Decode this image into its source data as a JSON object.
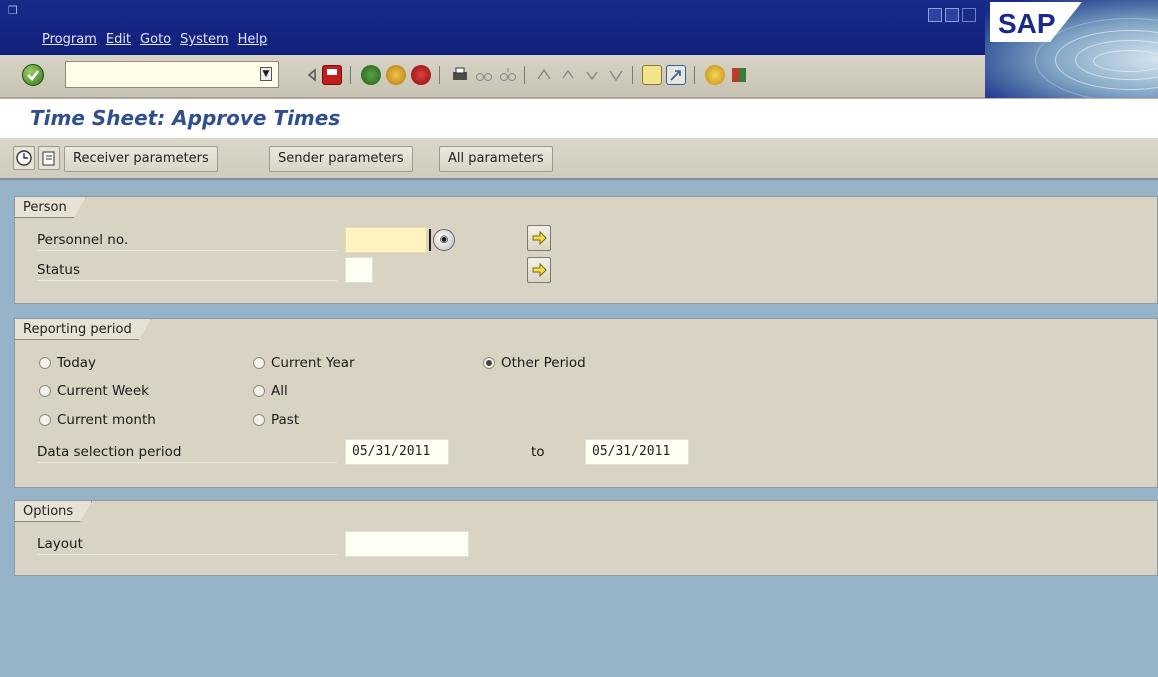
{
  "menu": [
    "Program",
    "Edit",
    "Goto",
    "System",
    "Help"
  ],
  "brand": "SAP",
  "page_title": "Time Sheet: Approve Times",
  "app_toolbar": {
    "buttons": [
      "Receiver parameters",
      "Sender parameters",
      "All parameters"
    ]
  },
  "person": {
    "group_label": "Person",
    "personnel_no_label": "Personnel no.",
    "personnel_no_value": "",
    "status_label": "Status",
    "status_value": ""
  },
  "reporting_period": {
    "group_label": "Reporting period",
    "options": [
      {
        "label": "Today",
        "selected": false
      },
      {
        "label": "Current Week",
        "selected": false
      },
      {
        "label": "Current month",
        "selected": false
      },
      {
        "label": "Current Year",
        "selected": false
      },
      {
        "label": "All",
        "selected": false
      },
      {
        "label": "Past",
        "selected": false
      },
      {
        "label": "Other Period",
        "selected": true
      }
    ],
    "data_selection_label": "Data selection period",
    "from_date": "05/31/2011",
    "to_label": "to",
    "to_date": "05/31/2011"
  },
  "options": {
    "group_label": "Options",
    "layout_label": "Layout",
    "layout_value": ""
  },
  "colors": {
    "title_bar": "#1a2a8a",
    "page_title": "#2f4f8f",
    "background": "#97b3c7",
    "group_bg": "#d8d3c2"
  }
}
